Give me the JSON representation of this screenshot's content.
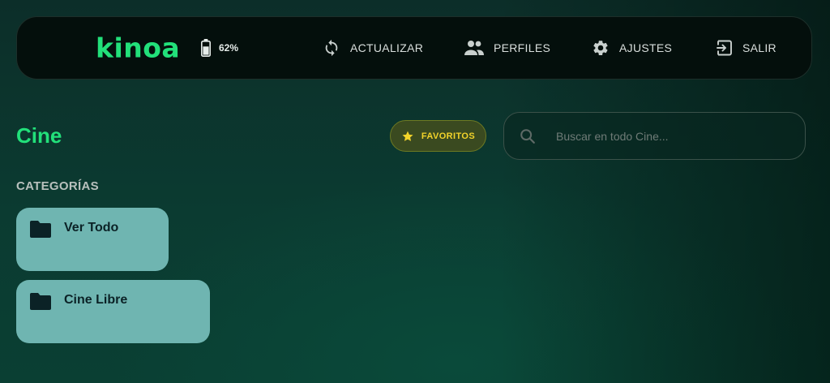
{
  "header": {
    "back_icon": "arrow-left-icon",
    "logo": "kinoa",
    "battery": {
      "icon": "battery-icon",
      "percent_label": "62%",
      "level": 0.62
    },
    "nav": [
      {
        "id": "refresh",
        "icon": "refresh-icon",
        "label": "ACTUALIZAR"
      },
      {
        "id": "profiles",
        "icon": "people-icon",
        "label": "PERFILES"
      },
      {
        "id": "settings",
        "icon": "gear-icon",
        "label": "AJUSTES"
      },
      {
        "id": "exit",
        "icon": "exit-icon",
        "label": "SALIR"
      }
    ]
  },
  "page": {
    "title": "Cine",
    "favorites_label": "FAVORITOS",
    "search_placeholder": "Buscar en todo Cine...",
    "categories_title": "CATEGORÍAS",
    "categories": [
      {
        "label": "Ver Todo",
        "icon": "folder-icon"
      },
      {
        "label": "Cine Libre",
        "icon": "folder-icon"
      }
    ]
  },
  "colors": {
    "accent": "#22e07a",
    "favorites_text": "#f2d32a",
    "card": "#6fb5b1"
  }
}
